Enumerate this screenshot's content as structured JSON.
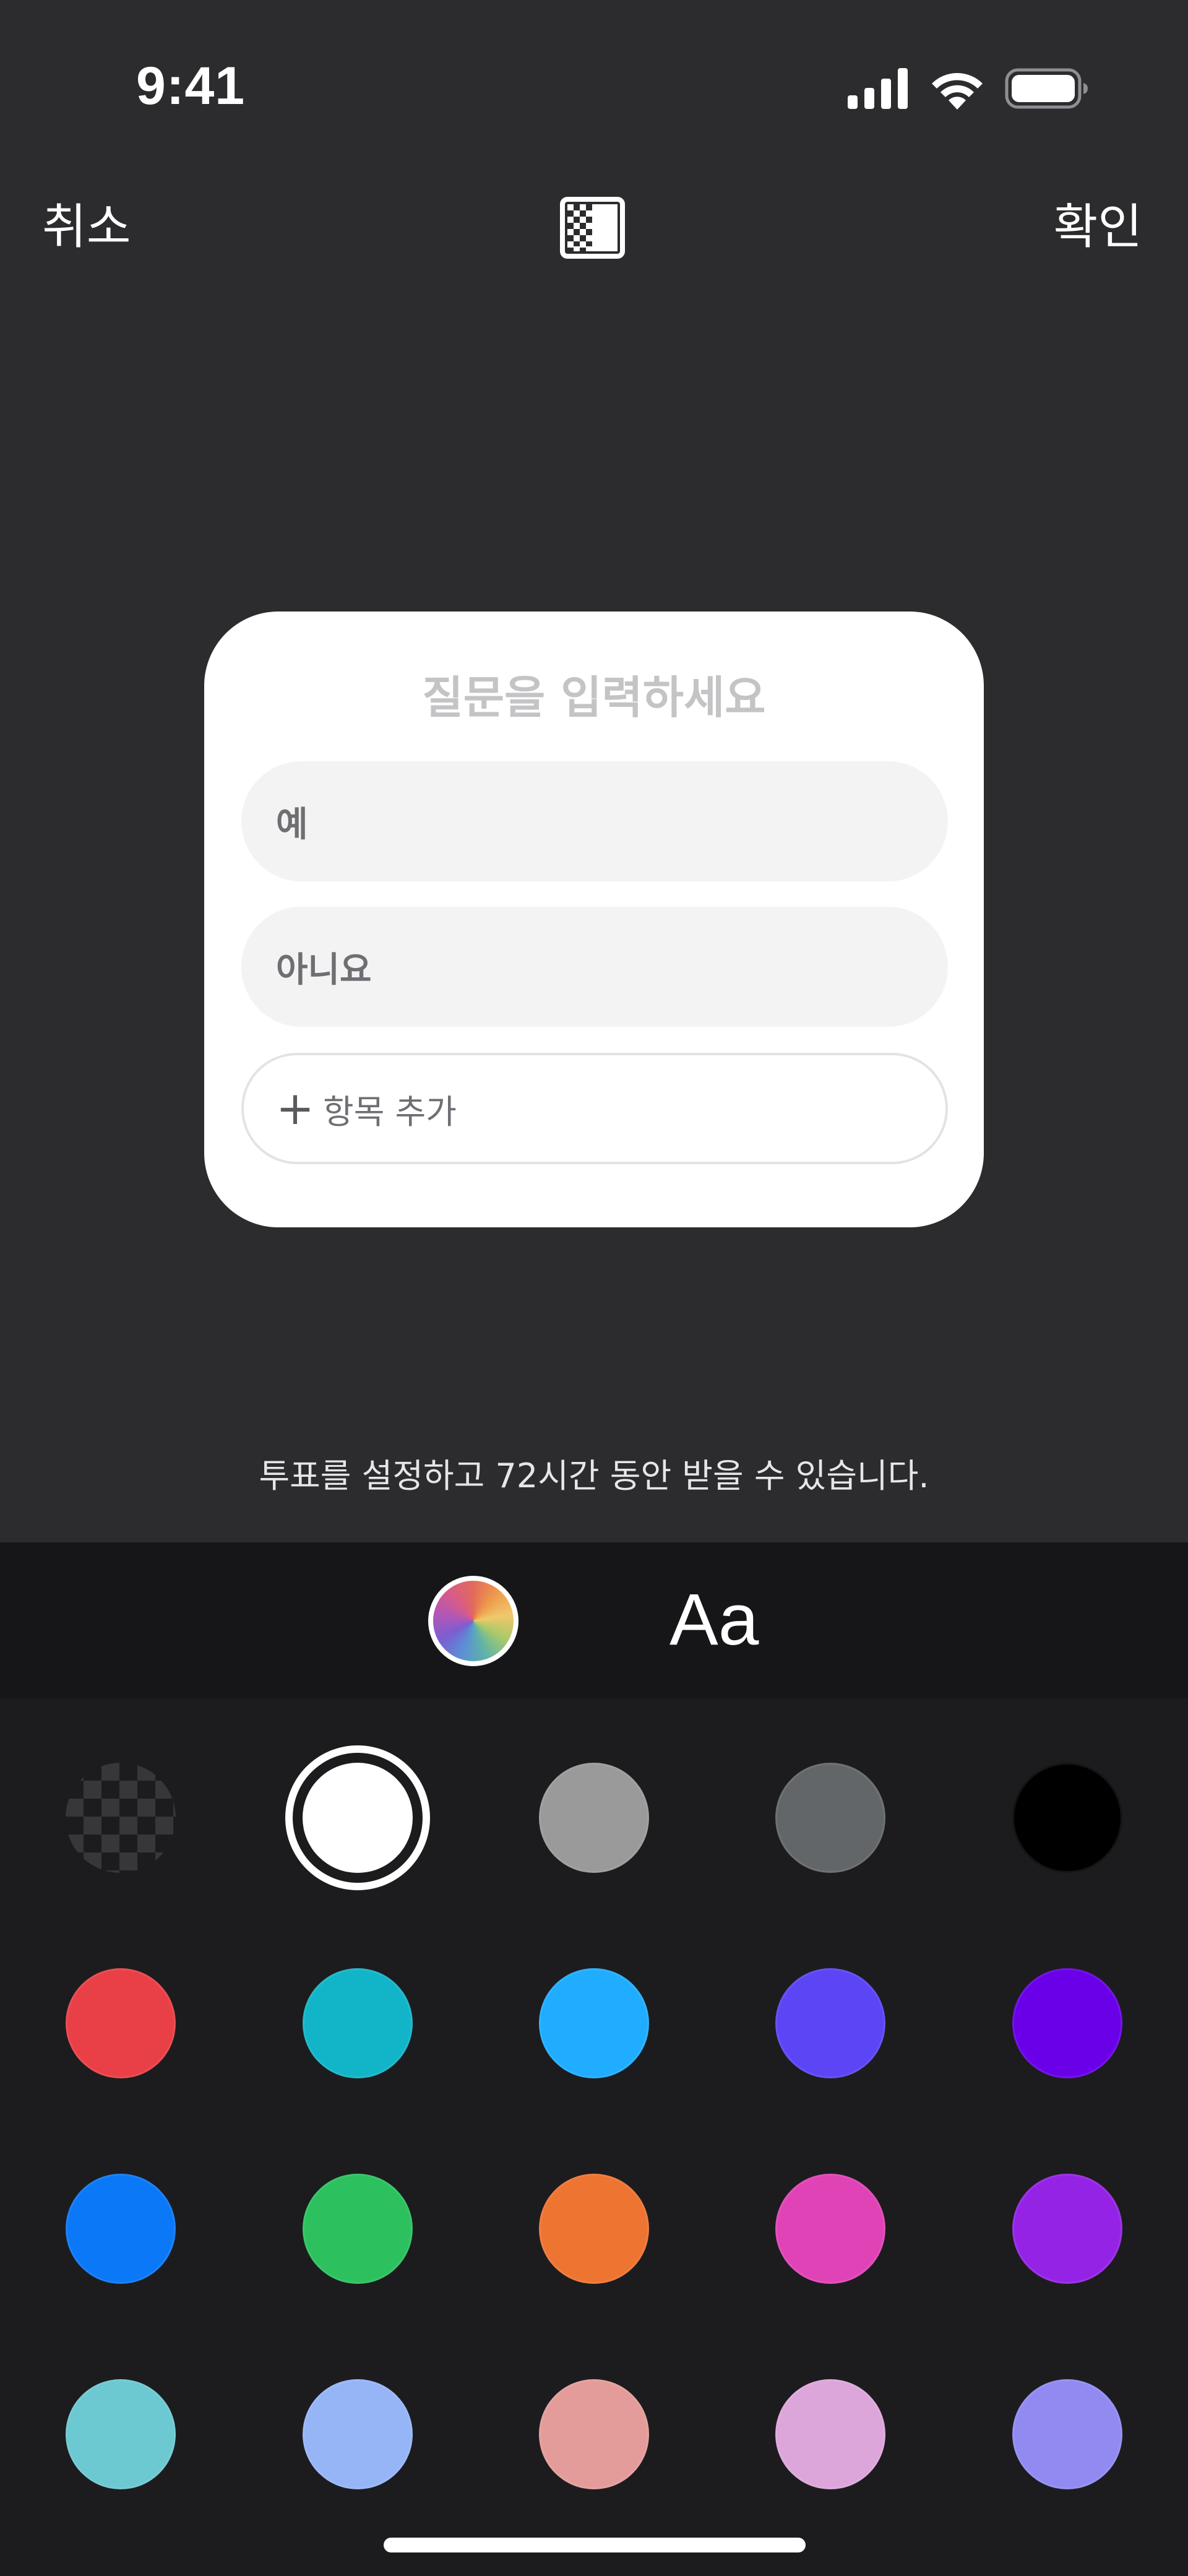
{
  "status_bar": {
    "time": "9:41",
    "icons": [
      "cellular-signal-icon",
      "wifi-icon",
      "battery-icon"
    ]
  },
  "nav": {
    "cancel_label": "취소",
    "confirm_label": "확인",
    "background_toggle_icon": "transparency-toggle-icon"
  },
  "poll": {
    "question_placeholder": "질문을 입력하세요",
    "options": [
      "예",
      "아니요"
    ],
    "add_option_label": "항목 추가"
  },
  "hint": "투표를 설정하고 72시간 동안 받을 수 있습니다.",
  "toolbar": {
    "color_wheel_icon": "color-wheel-icon",
    "font_label": "Aa"
  },
  "palette": {
    "selected": "#FFFFFF",
    "colors": [
      [
        "transparent",
        "#FFFFFF",
        "#9A9A9A",
        "#636668",
        "#000000"
      ],
      [
        "#E84046",
        "#12B5C8",
        "#20ADFF",
        "#5B45F5",
        "#6A00E8"
      ],
      [
        "#0A78F7",
        "#2CC15E",
        "#EE7431",
        "#E043B6",
        "#9523E6"
      ],
      [
        "#6CC8D1",
        "#96B5F7",
        "#E49C9A",
        "#DDA6DB",
        "#918AF1"
      ]
    ]
  }
}
